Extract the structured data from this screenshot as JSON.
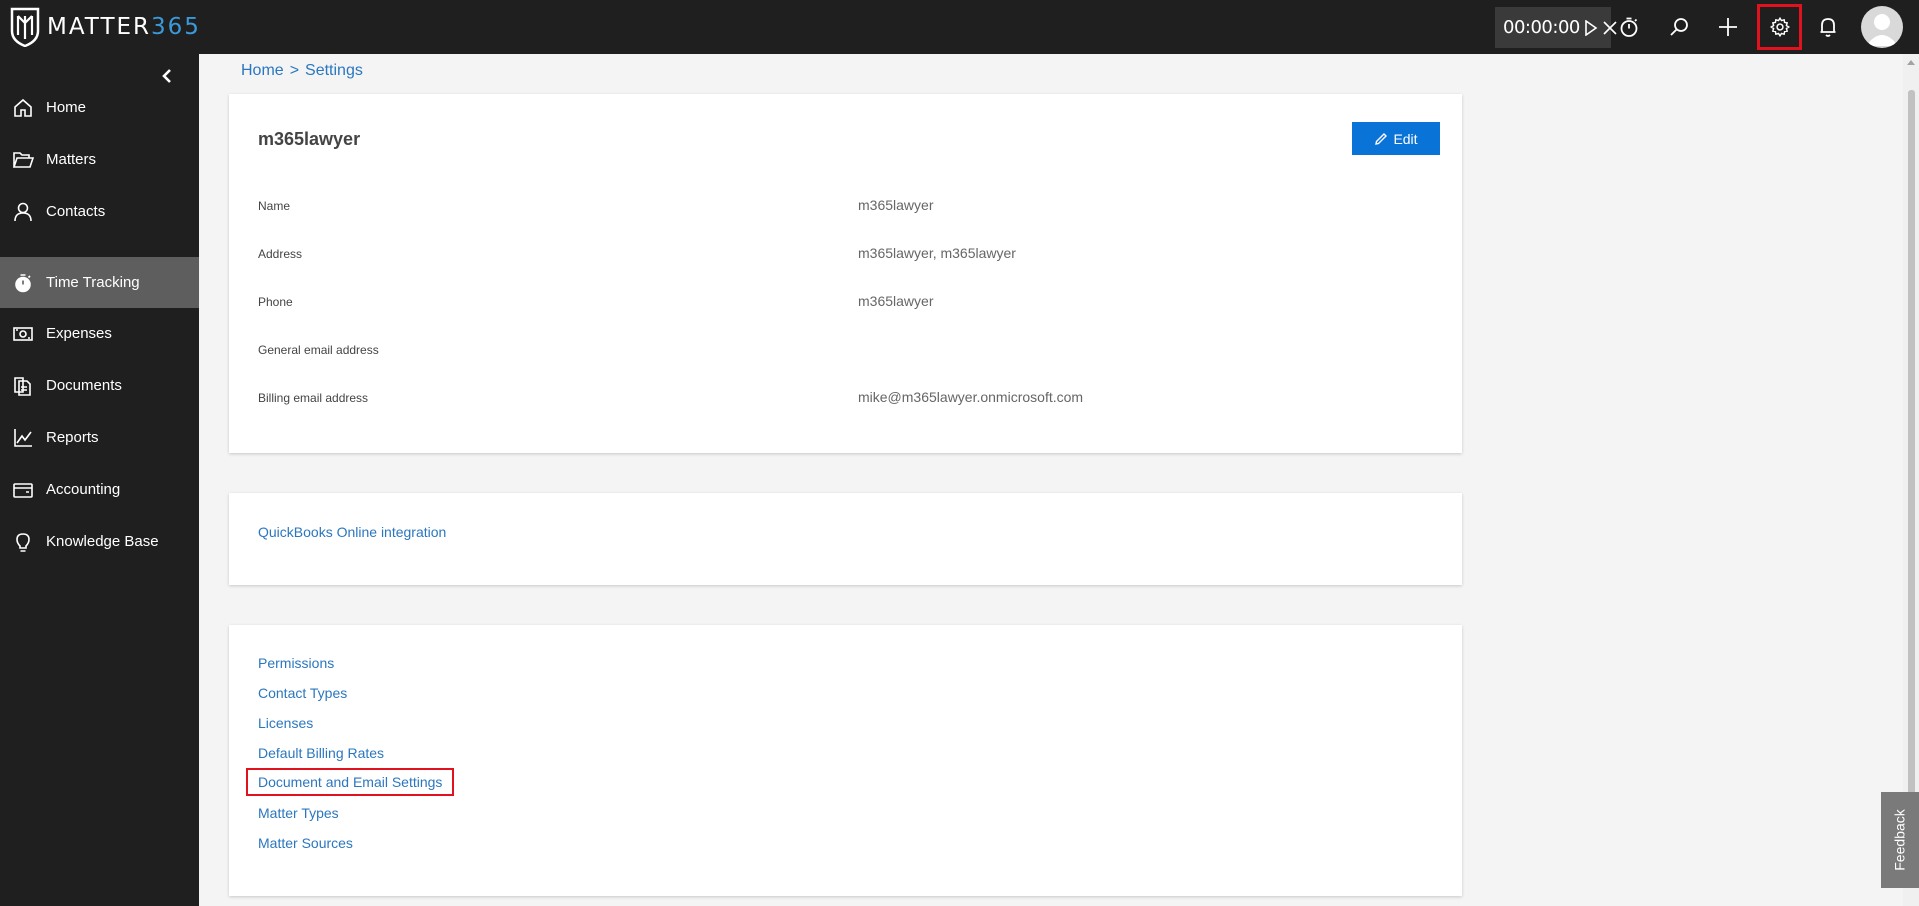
{
  "app": {
    "logo_word_white": "MATTER",
    "logo_word_blue": "365",
    "brand_blue": "#3a9ad9"
  },
  "topbar": {
    "timer": "00:00:00",
    "icons": [
      "play-icon",
      "close-icon",
      "stopwatch-icon",
      "search-icon",
      "plus-icon",
      "gear-icon",
      "bell-icon",
      "avatar"
    ]
  },
  "sidebar": {
    "items": [
      {
        "label": "Home",
        "icon": "home-icon"
      },
      {
        "label": "Matters",
        "icon": "folder-open-icon"
      },
      {
        "label": "Contacts",
        "icon": "person-icon"
      },
      {
        "label": "Time Tracking",
        "icon": "stopwatch-icon",
        "active": true
      },
      {
        "label": "Expenses",
        "icon": "money-icon"
      },
      {
        "label": "Documents",
        "icon": "documents-icon"
      },
      {
        "label": "Reports",
        "icon": "chart-icon"
      },
      {
        "label": "Accounting",
        "icon": "wallet-icon"
      },
      {
        "label": "Knowledge Base",
        "icon": "lightbulb-icon"
      }
    ]
  },
  "breadcrumb": {
    "home": "Home",
    "separator": ">",
    "current": "Settings"
  },
  "org": {
    "title": "m365lawyer",
    "edit_label": "Edit",
    "fields": [
      {
        "label": "Name",
        "value": "m365lawyer"
      },
      {
        "label": "Address",
        "value": "m365lawyer, m365lawyer"
      },
      {
        "label": "Phone",
        "value": "m365lawyer"
      },
      {
        "label": "General email address",
        "value": ""
      },
      {
        "label": "Billing email address",
        "value": "mike@m365lawyer.onmicrosoft.com"
      }
    ]
  },
  "integration": {
    "link": "QuickBooks Online integration"
  },
  "settings_links": [
    "Permissions",
    "Contact Types",
    "Licenses",
    "Default Billing Rates",
    "Document and Email Settings",
    "Matter Types",
    "Matter Sources"
  ],
  "feedback_label": "Feedback",
  "colors": {
    "link": "#2b77bf",
    "edit_button": "#0a73d8",
    "highlight": "#e0121d",
    "sidebar_bg": "#1f1f1f",
    "sidebar_active": "#5e5e5e"
  }
}
